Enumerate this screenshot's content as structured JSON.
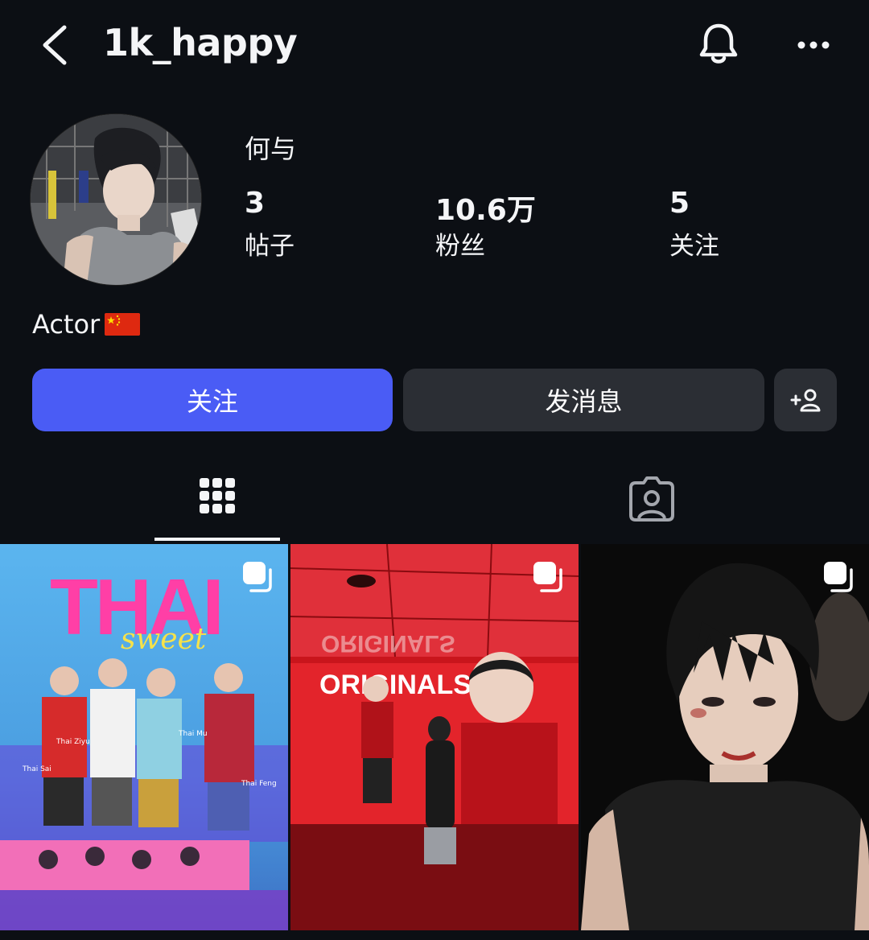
{
  "header": {
    "username": "1k_happy"
  },
  "profile": {
    "display_name": "何与",
    "stats": [
      {
        "value": "3",
        "label": "帖子"
      },
      {
        "value": "10.6万",
        "label": "粉丝"
      },
      {
        "value": "5",
        "label": "关注"
      }
    ],
    "bio": "Actor"
  },
  "actions": {
    "follow_label": "关注",
    "message_label": "发消息"
  },
  "posts": [
    {
      "title": "THAI",
      "script": "sweet",
      "captions": [
        "Thai Ziyu",
        "Thai Sai",
        "Thai Mu",
        "Thai Feng"
      ]
    },
    {
      "sign": "ORIGINALS",
      "mirror_sign": "ORIGINALS"
    },
    {}
  ],
  "colors": {
    "accent": "#4a5cf5",
    "background": "#0c0f14",
    "button_dark": "#2b2e34"
  },
  "icons": [
    "back-icon",
    "bell-icon",
    "more-icon",
    "add-person-icon",
    "grid-icon",
    "tagged-icon",
    "multi-post-icon"
  ]
}
